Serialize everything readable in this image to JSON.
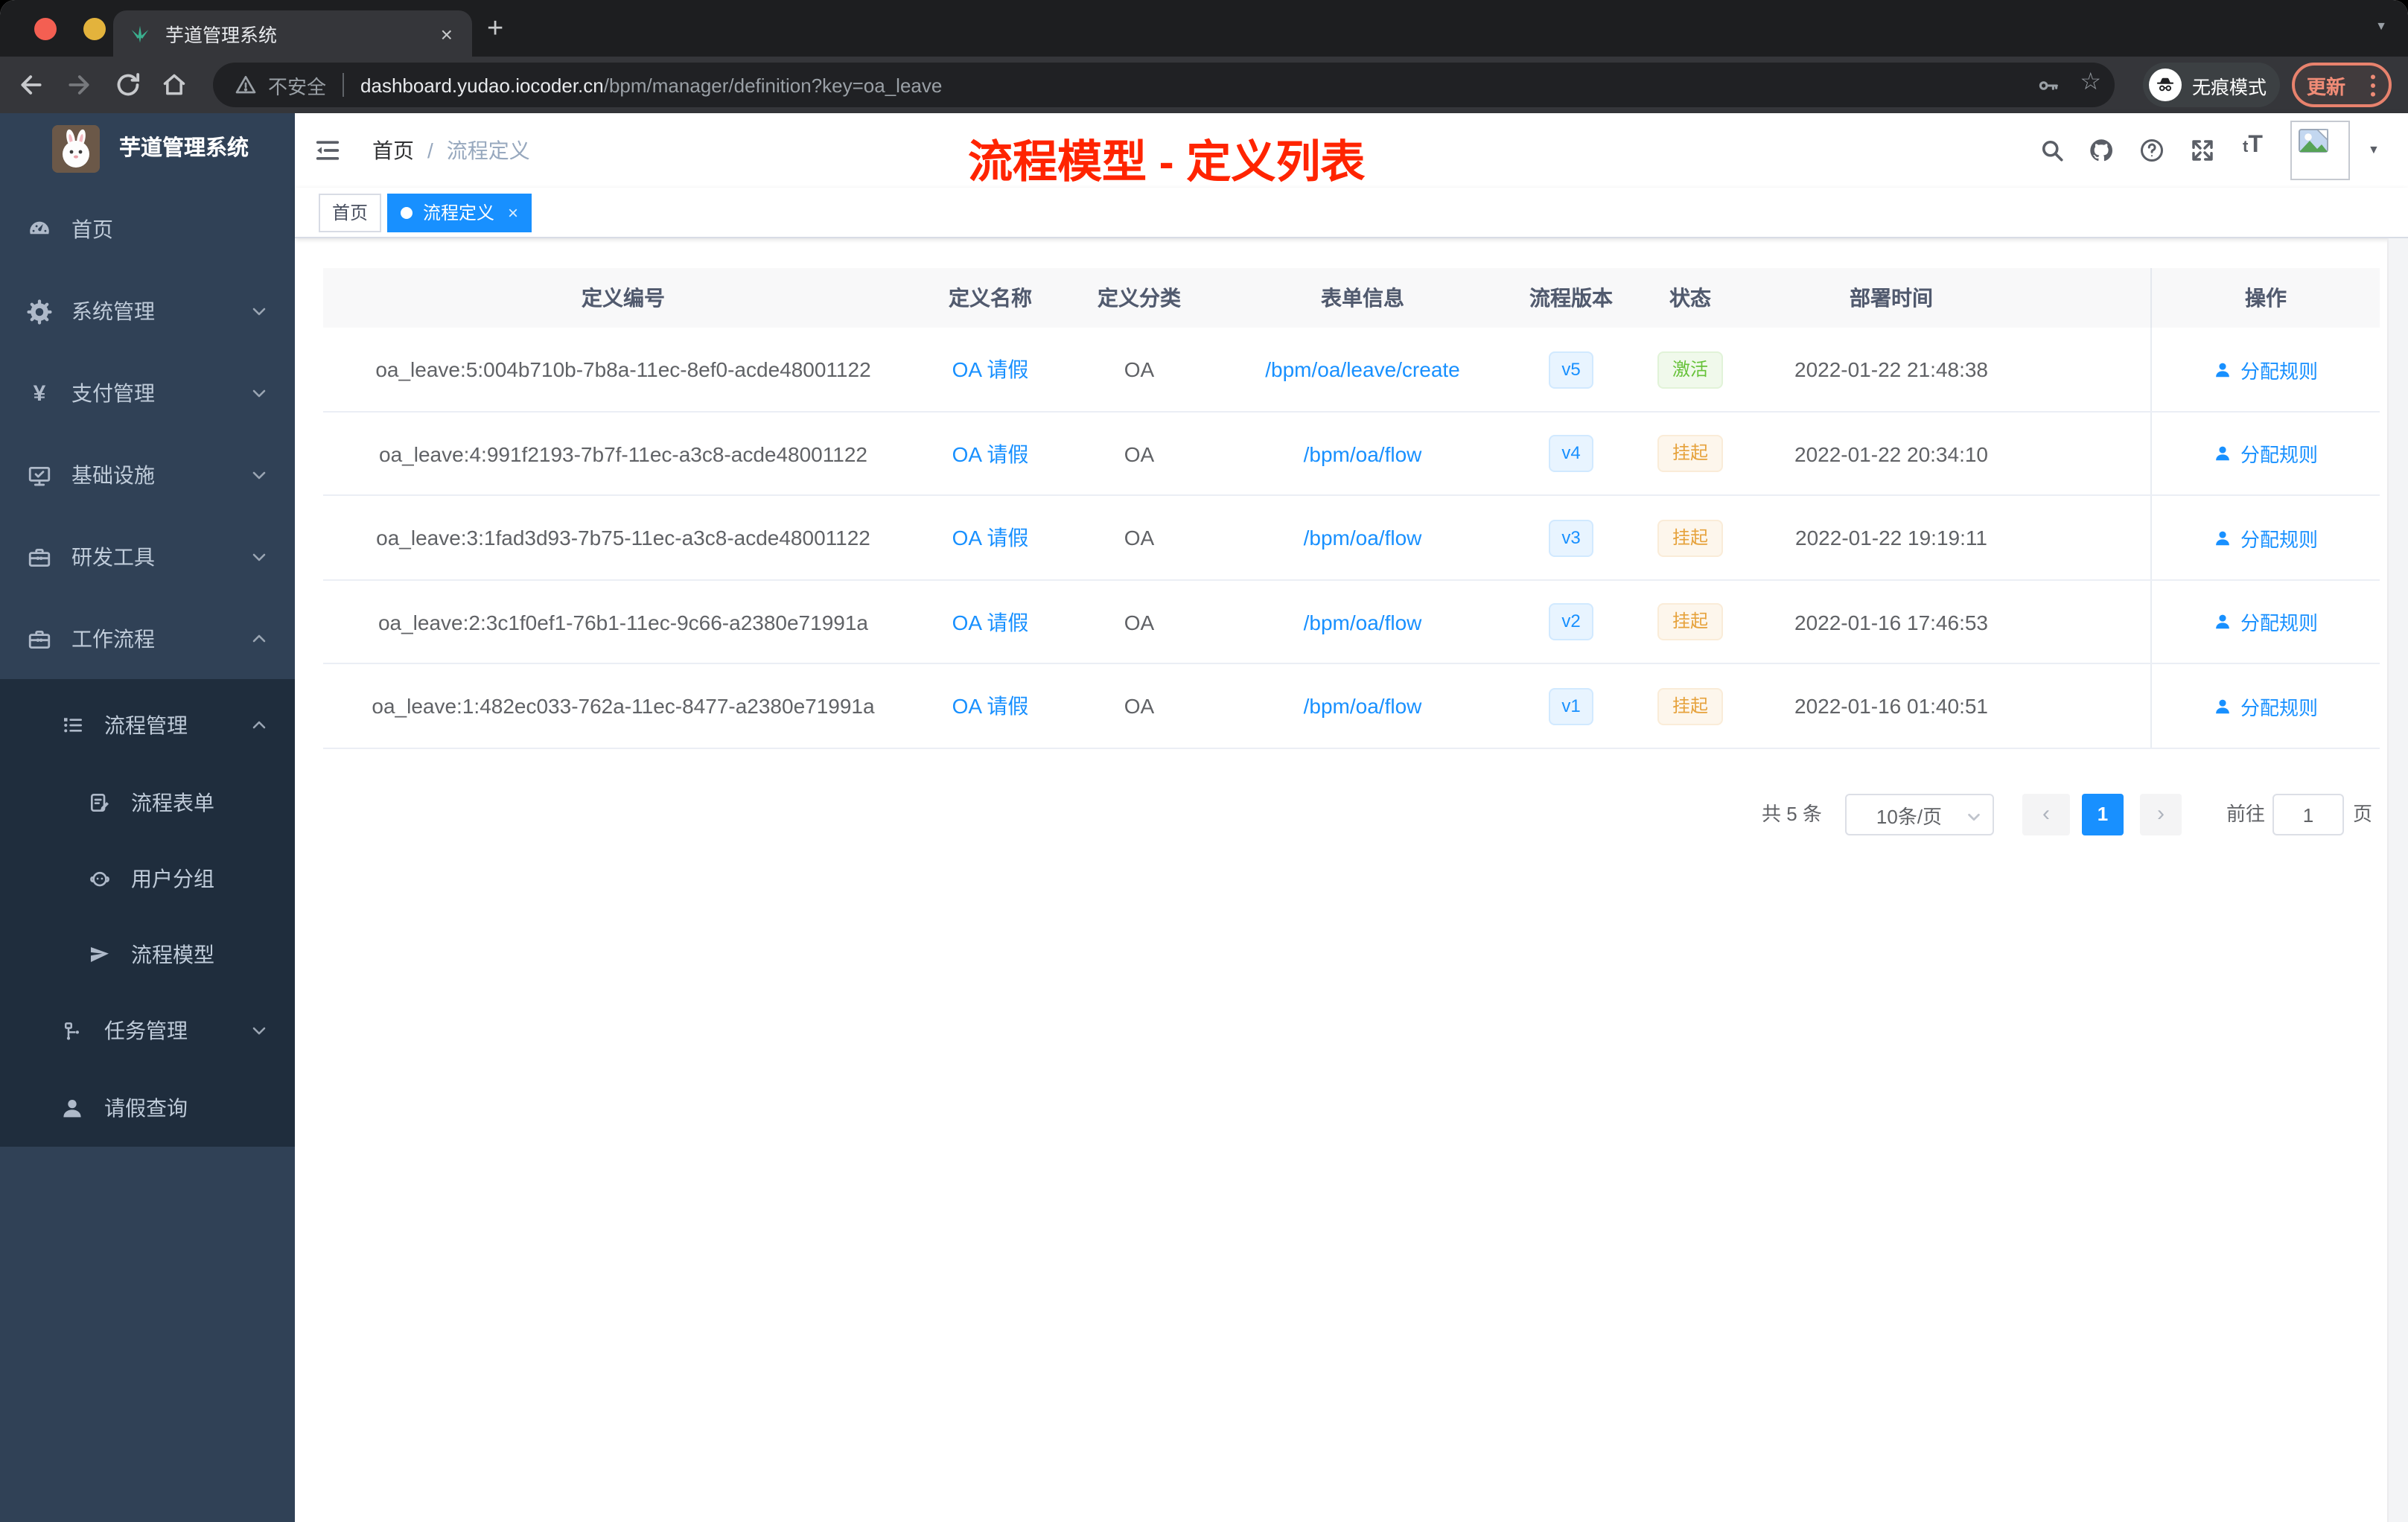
{
  "browser": {
    "tab": {
      "title": "芋道管理系统",
      "close_glyph": "×",
      "new_tab_glyph": "+"
    },
    "toolbar": {
      "security_label": "不安全",
      "url_host": "dashboard.yudao.iocoder.cn",
      "url_path": "/bpm/manager/definition?key=oa_leave",
      "star_glyph": "☆",
      "incognito_label": "无痕模式",
      "update_label": "更新"
    }
  },
  "sidebar": {
    "logo_title": "芋道管理系统",
    "items": [
      {
        "label": "首页",
        "icon": "dashboard-icon"
      },
      {
        "label": "系统管理",
        "icon": "gear-icon",
        "arrow": "down"
      },
      {
        "label": "支付管理",
        "icon": "yen-icon",
        "glyph": "¥",
        "arrow": "down"
      },
      {
        "label": "基础设施",
        "icon": "monitor-icon",
        "arrow": "down"
      },
      {
        "label": "研发工具",
        "icon": "toolbox-icon",
        "arrow": "down"
      },
      {
        "label": "工作流程",
        "icon": "toolbox-icon",
        "arrow": "up"
      },
      {
        "label": "流程管理",
        "icon": "list-tree-icon",
        "arrow": "up"
      },
      {
        "label": "流程表单",
        "icon": "form-edit-icon"
      },
      {
        "label": "用户分组",
        "icon": "user-group-icon"
      },
      {
        "label": "流程模型",
        "icon": "paper-plane-icon"
      },
      {
        "label": "任务管理",
        "icon": "org-tree-icon",
        "arrow": "down"
      },
      {
        "label": "请假查询",
        "icon": "user-icon"
      }
    ]
  },
  "navbar": {
    "breadcrumb": {
      "items": [
        "首页",
        "流程定义"
      ],
      "separator": "/"
    },
    "annotation": "流程模型 - 定义列表"
  },
  "tagbar": {
    "tags": [
      {
        "label": "首页",
        "active": false
      },
      {
        "label": "流程定义",
        "active": true,
        "close_glyph": "×"
      }
    ]
  },
  "table": {
    "columns": [
      "定义编号",
      "定义名称",
      "定义分类",
      "表单信息",
      "流程版本",
      "状态",
      "部署时间",
      "操作"
    ],
    "rows": [
      {
        "id": "oa_leave:5:004b710b-7b8a-11ec-8ef0-acde48001122",
        "name": "OA 请假",
        "category": "OA",
        "form": "/bpm/oa/leave/create",
        "version": "v5",
        "status": "激活",
        "deployed_at": "2022-01-22 21:48:38",
        "action": "分配规则"
      },
      {
        "id": "oa_leave:4:991f2193-7b7f-11ec-a3c8-acde48001122",
        "name": "OA 请假",
        "category": "OA",
        "form": "/bpm/oa/flow",
        "version": "v4",
        "status": "挂起",
        "deployed_at": "2022-01-22 20:34:10",
        "action": "分配规则"
      },
      {
        "id": "oa_leave:3:1fad3d93-7b75-11ec-a3c8-acde48001122",
        "name": "OA 请假",
        "category": "OA",
        "form": "/bpm/oa/flow",
        "version": "v3",
        "status": "挂起",
        "deployed_at": "2022-01-22 19:19:11",
        "action": "分配规则"
      },
      {
        "id": "oa_leave:2:3c1f0ef1-76b1-11ec-9c66-a2380e71991a",
        "name": "OA 请假",
        "category": "OA",
        "form": "/bpm/oa/flow",
        "version": "v2",
        "status": "挂起",
        "deployed_at": "2022-01-16 17:46:53",
        "action": "分配规则"
      },
      {
        "id": "oa_leave:1:482ec033-762a-11ec-8477-a2380e71991a",
        "name": "OA 请假",
        "category": "OA",
        "form": "/bpm/oa/flow",
        "version": "v1",
        "status": "挂起",
        "deployed_at": "2022-01-16 01:40:51",
        "action": "分配规则"
      }
    ]
  },
  "pagination": {
    "total": "共 5 条",
    "page_size": "10条/页",
    "prev_glyph": "‹",
    "current_page": "1",
    "next_glyph": "›",
    "goto_label": "前往",
    "goto_value": "1",
    "unit_label": "页"
  },
  "colors": {
    "accent": "#1890ff",
    "sidebar_bg": "#304156",
    "submenu_bg": "#1f2d3d",
    "annotation_red": "#ff2400",
    "status_active": "#67c23a",
    "status_suspend": "#e6a23c",
    "update_salmon": "#e8826d"
  }
}
